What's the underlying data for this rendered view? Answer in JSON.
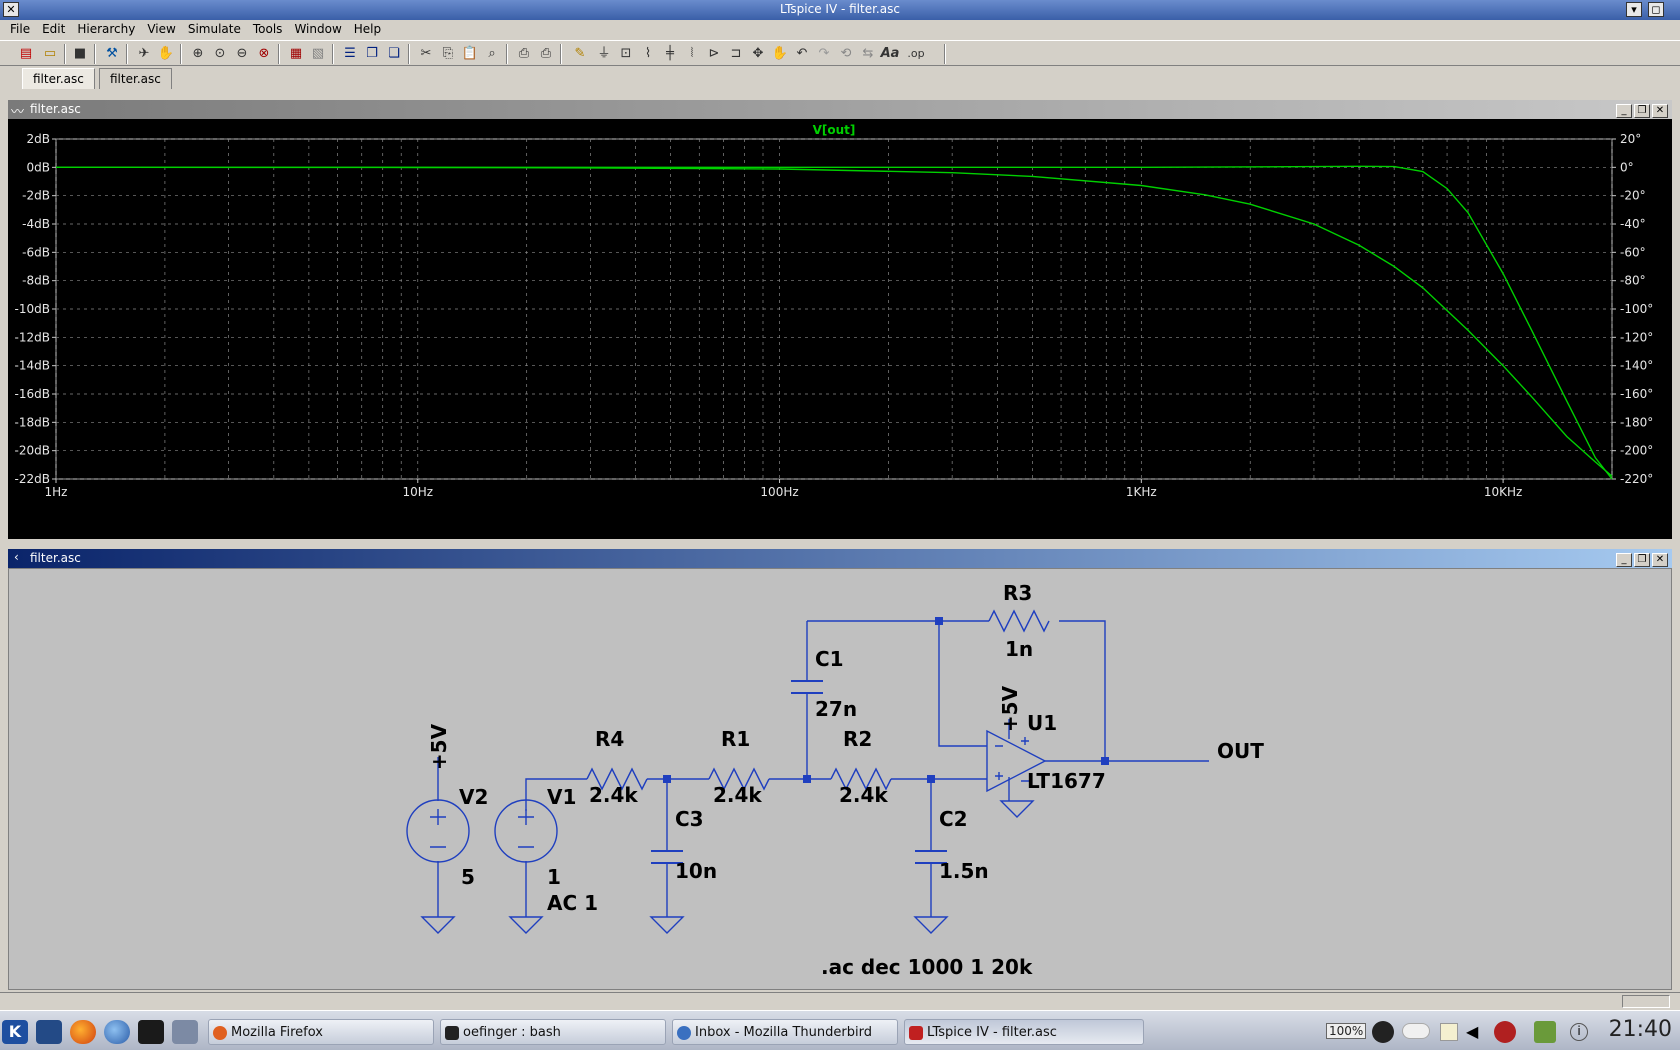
{
  "window": {
    "title": "LTspice IV - filter.asc"
  },
  "menu": [
    "File",
    "Edit",
    "Hierarchy",
    "View",
    "Simulate",
    "Tools",
    "Window",
    "Help"
  ],
  "tabs": [
    {
      "label": "filter.asc",
      "active": true
    },
    {
      "label": "filter.asc",
      "active": false
    }
  ],
  "plot_window": {
    "title": "filter.asc"
  },
  "schematic_window": {
    "title": "filter.asc"
  },
  "chart_data": {
    "type": "line",
    "title": "V[out]",
    "x_scale": "log",
    "x_range_hz": [
      1,
      20000
    ],
    "x_ticks": [
      {
        "value": 1,
        "label": "1Hz"
      },
      {
        "value": 10,
        "label": "10Hz"
      },
      {
        "value": 100,
        "label": "100Hz"
      },
      {
        "value": 1000,
        "label": "1KHz"
      },
      {
        "value": 10000,
        "label": "10KHz"
      }
    ],
    "y_left_range_db": [
      -22,
      2
    ],
    "y_left_ticks": [
      "2dB",
      "0dB",
      "-2dB",
      "-4dB",
      "-6dB",
      "-8dB",
      "-10dB",
      "-12dB",
      "-14dB",
      "-16dB",
      "-18dB",
      "-20dB",
      "-22dB"
    ],
    "y_right_range_deg": [
      -220,
      20
    ],
    "y_right_ticks": [
      "20°",
      "0°",
      "-20°",
      "-40°",
      "-60°",
      "-80°",
      "-100°",
      "-120°",
      "-140°",
      "-160°",
      "-180°",
      "-200°",
      "-220°"
    ],
    "grid": true,
    "trace_color": "#00d000",
    "series": [
      {
        "axis": "left",
        "x": [
          1,
          10,
          100,
          1000,
          3000,
          4000,
          5000,
          6000,
          7000,
          8000,
          10000,
          12000,
          15000,
          18000,
          20000
        ],
        "values": [
          0,
          0,
          0,
          0,
          0.05,
          0.07,
          0.05,
          -0.3,
          -1.5,
          -3.2,
          -7.5,
          -11.5,
          -16.5,
          -20.5,
          -22
        ]
      },
      {
        "axis": "right",
        "x": [
          1,
          10,
          30,
          100,
          300,
          500,
          1000,
          1500,
          2000,
          3000,
          4000,
          5000,
          6000,
          8000,
          10000,
          12000,
          15000,
          18000,
          20000
        ],
        "values": [
          0,
          -0.1,
          -0.4,
          -1.2,
          -3.8,
          -6.4,
          -12.8,
          -19.4,
          -26,
          -40,
          -55,
          -70,
          -85,
          -115,
          -140,
          -162,
          -190,
          -208,
          -218
        ]
      }
    ]
  },
  "schematic": {
    "components": {
      "R3": {
        "name": "R3",
        "value": "1n"
      },
      "C1": {
        "name": "C1",
        "value": "27n"
      },
      "R4": {
        "name": "R4",
        "value": "2.4k"
      },
      "R1": {
        "name": "R1",
        "value": "2.4k"
      },
      "R2": {
        "name": "R2",
        "value": "2.4k"
      },
      "C3": {
        "name": "C3",
        "value": "10n"
      },
      "C2": {
        "name": "C2",
        "value": "1.5n"
      },
      "V2": {
        "name": "V2",
        "value": "5"
      },
      "V1": {
        "name": "V1",
        "value": "1",
        "ac": "AC 1"
      },
      "U1": {
        "name": "U1",
        "value": "LT1677"
      }
    },
    "labels": {
      "supply_v2": "+5V",
      "supply_u1": "+5V",
      "out": "OUT"
    },
    "directive": ".ac dec 1000 1 20k"
  },
  "taskbar": {
    "tasks": [
      {
        "label": "Mozilla Firefox",
        "active": false
      },
      {
        "label": "oefinger : bash",
        "active": false
      },
      {
        "label": "Inbox - Mozilla Thunderbird",
        "active": false
      },
      {
        "label": "LTspice IV - filter.asc",
        "active": true
      }
    ],
    "battery": "100%",
    "clock": "21:40"
  }
}
